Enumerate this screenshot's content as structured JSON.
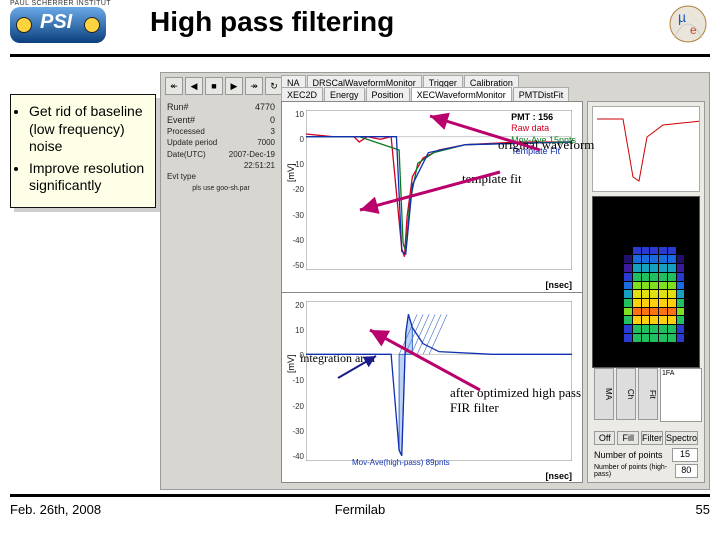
{
  "title": "High pass filtering",
  "logo_top": "PAUL SCHERRER INSTITUT",
  "logo_text": "PSI",
  "note_items": [
    "Get rid of baseline (low frequency) noise",
    "Improve resolution significantly"
  ],
  "footer": {
    "left": "Feb. 26th, 2008",
    "center": "Fermilab",
    "right": "55"
  },
  "annotations": {
    "orig": "original waveform",
    "tmpl": "template fit",
    "intg": "integration area",
    "after": "after optimized high pass FIR filter"
  },
  "window": {
    "toolbar_glyphs": [
      "↞",
      "◀",
      "■",
      "▶",
      "↠",
      "↻"
    ],
    "tabs": [
      "NA",
      "DRSCalWaveformMonitor",
      "Trigger",
      "Calibration"
    ],
    "tabs2": [
      "XEC2D",
      "Energy",
      "Position",
      "XECWaveformMonitor",
      "PMTDistFit"
    ],
    "info": {
      "Run": "4770",
      "Event": "0",
      "Processed": "3",
      "Update period": "7000",
      "Date(UTC)": "2007-Dec-19",
      "Time": "22:51:21",
      "Event type": "pls use goo-sh.par"
    },
    "side": {
      "bar_btns": [
        "MA",
        "Ch",
        "Fit"
      ],
      "btn_row": [
        "Off",
        "Fill",
        "Filter",
        "Spectro"
      ],
      "points_label": "Number of points",
      "points_val": "15",
      "hp_label": "Number of points (high-pass)",
      "hp_val": "80"
    }
  },
  "chart_data": [
    {
      "type": "line",
      "title": "",
      "xlabel": "[nsec]",
      "ylabel": "[mV]",
      "ylim": [
        -50,
        10
      ],
      "yticks": [
        10,
        0,
        -10,
        -20,
        -30,
        -40,
        -50
      ],
      "xlim": [
        -200,
        800
      ],
      "legend": {
        "heading": "PMT : 156",
        "items": [
          "Raw data",
          "Mov-Ave 15pnts",
          "Template Fit"
        ]
      },
      "series": [
        {
          "name": "Raw data",
          "color": "#d00020",
          "values": [
            [
              -200,
              1
            ],
            [
              -100,
              0
            ],
            [
              -20,
              0
            ],
            [
              0,
              -2
            ],
            [
              30,
              0
            ],
            [
              80,
              -1
            ],
            [
              120,
              0
            ],
            [
              160,
              -42
            ],
            [
              170,
              -45
            ],
            [
              180,
              -30
            ],
            [
              200,
              -15
            ],
            [
              240,
              -8
            ],
            [
              300,
              -5
            ],
            [
              400,
              -3
            ],
            [
              600,
              -2
            ],
            [
              800,
              -2
            ]
          ]
        },
        {
          "name": "Mov-Ave 15pnts",
          "color": "#0a7a20",
          "values": [
            [
              -200,
              0
            ],
            [
              0,
              0
            ],
            [
              150,
              -5
            ],
            [
              165,
              -40
            ],
            [
              175,
              -43
            ],
            [
              190,
              -25
            ],
            [
              220,
              -10
            ],
            [
              280,
              -6
            ],
            [
              400,
              -3
            ],
            [
              800,
              -2
            ]
          ]
        },
        {
          "name": "Template Fit",
          "color": "#1030b0",
          "values": [
            [
              -200,
              0
            ],
            [
              140,
              0
            ],
            [
              160,
              -43
            ],
            [
              175,
              -44
            ],
            [
              200,
              -18
            ],
            [
              260,
              -6
            ],
            [
              400,
              -3
            ],
            [
              800,
              -2
            ]
          ]
        }
      ]
    },
    {
      "type": "line",
      "title": "",
      "xlabel": "[nsec]",
      "ylabel": "[mV]",
      "ylim": [
        -40,
        20
      ],
      "yticks": [
        20,
        10,
        0,
        -10,
        -20,
        -30,
        -40
      ],
      "xlim": [
        -200,
        800
      ],
      "annotation": "Mov-Ave(high-pass) 89pnts",
      "series": [
        {
          "name": "High-pass",
          "color": "#1030b0",
          "values": [
            [
              -200,
              0
            ],
            [
              120,
              0
            ],
            [
              150,
              -36
            ],
            [
              160,
              -38
            ],
            [
              175,
              8
            ],
            [
              185,
              15
            ],
            [
              200,
              10
            ],
            [
              240,
              4
            ],
            [
              300,
              1
            ],
            [
              500,
              0
            ],
            [
              800,
              0
            ]
          ]
        }
      ],
      "fill_region_x": [
        150,
        200
      ]
    }
  ]
}
